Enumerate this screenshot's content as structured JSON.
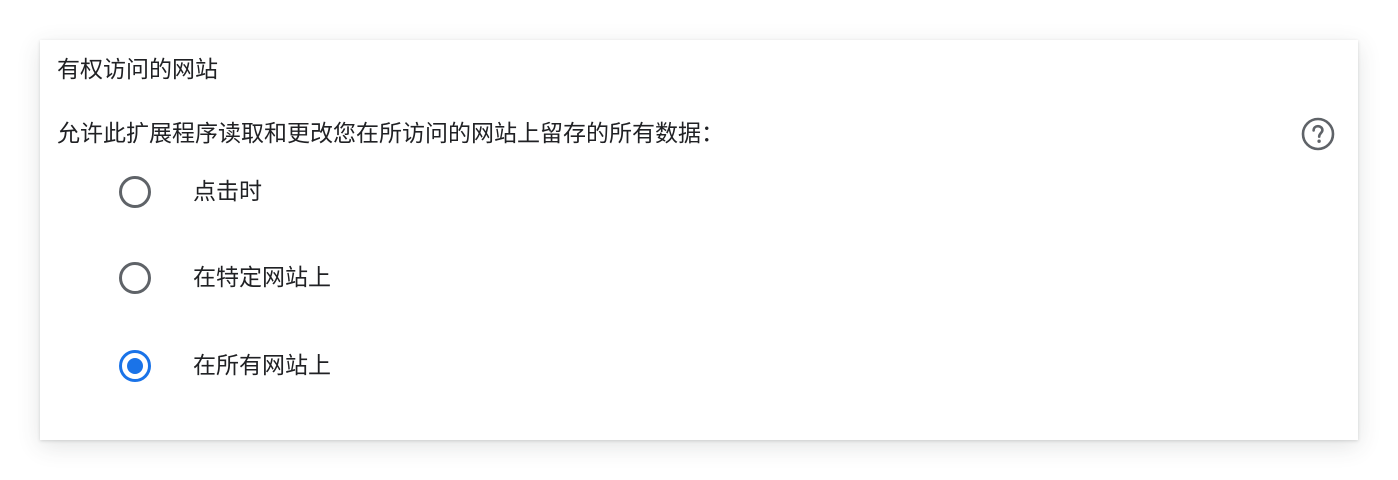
{
  "section": {
    "title": "有权访问的网站",
    "description": "允许此扩展程序读取和更改您在所访问的网站上留存的所有数据："
  },
  "help": {
    "icon": "help-circle-icon"
  },
  "options": [
    {
      "label": "点击时",
      "selected": false
    },
    {
      "label": "在特定网站上",
      "selected": false
    },
    {
      "label": "在所有网站上",
      "selected": true
    }
  ],
  "colors": {
    "accent": "#1a73e8",
    "radio_unchecked": "#5f6368",
    "text": "#202124",
    "help_icon": "#5f6368"
  }
}
